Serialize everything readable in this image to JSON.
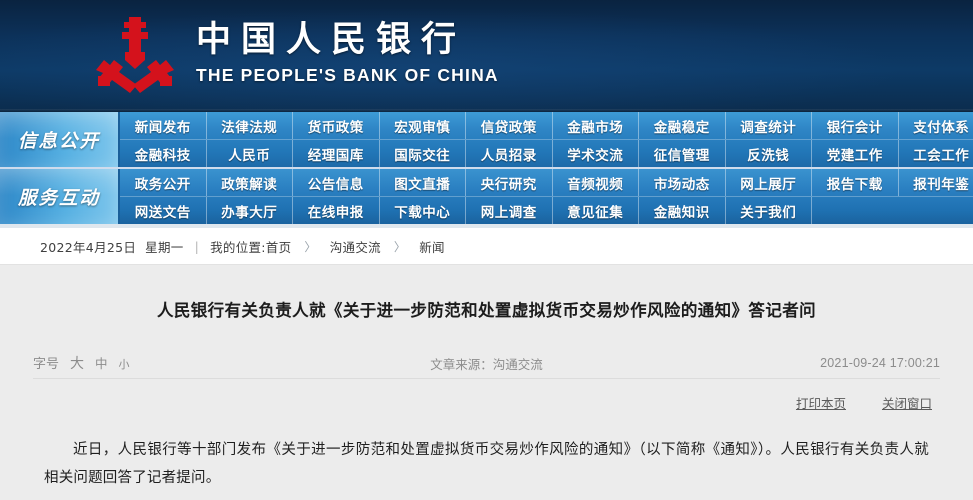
{
  "site": {
    "name_cn": "中国人民银行",
    "name_en": "THE PEOPLE'S BANK OF CHINA",
    "emblem_color": "#d4121c",
    "header_bg": "#0c3159"
  },
  "nav": {
    "groups": [
      {
        "label": "信息公开",
        "rows": [
          [
            "新闻发布",
            "法律法规",
            "货币政策",
            "宏观审慎",
            "信贷政策",
            "金融市场",
            "金融稳定",
            "调查统计",
            "银行会计",
            "支付体系"
          ],
          [
            "金融科技",
            "人民币",
            "经理国库",
            "国际交往",
            "人员招录",
            "学术交流",
            "征信管理",
            "反洗钱",
            "党建工作",
            "工会工作"
          ]
        ]
      },
      {
        "label": "服务互动",
        "rows": [
          [
            "政务公开",
            "政策解读",
            "公告信息",
            "图文直播",
            "央行研究",
            "音频视频",
            "市场动态",
            "网上展厅",
            "报告下载",
            "报刊年鉴"
          ],
          [
            "网送文告",
            "办事大厅",
            "在线申报",
            "下载中心",
            "网上调查",
            "意见征集",
            "金融知识",
            "关于我们",
            "",
            ""
          ]
        ]
      }
    ]
  },
  "breadcrumb": {
    "date": "2022年4月25日",
    "weekday": "星期一",
    "divider": "|",
    "position_label": "我的位置:首页",
    "arrow": "〉",
    "items": [
      "沟通交流",
      "新闻"
    ]
  },
  "article": {
    "title": "人民银行有关负责人就《关于进一步防范和处置虚拟货币交易炒作风险的通知》答记者问",
    "fontsize": {
      "label": "字号",
      "large": "大",
      "medium": "中",
      "small": "小"
    },
    "source": "文章来源：沟通交流",
    "publish_time": "2021-09-24 17:00:21",
    "actions": {
      "print": "打印本页",
      "close": "关闭窗口"
    },
    "body": "近日，人民银行等十部门发布《关于进一步防范和处置虚拟货币交易炒作风险的通知》（以下简称《通知》）。人民银行有关负责人就相关问题回答了记者提问。"
  }
}
